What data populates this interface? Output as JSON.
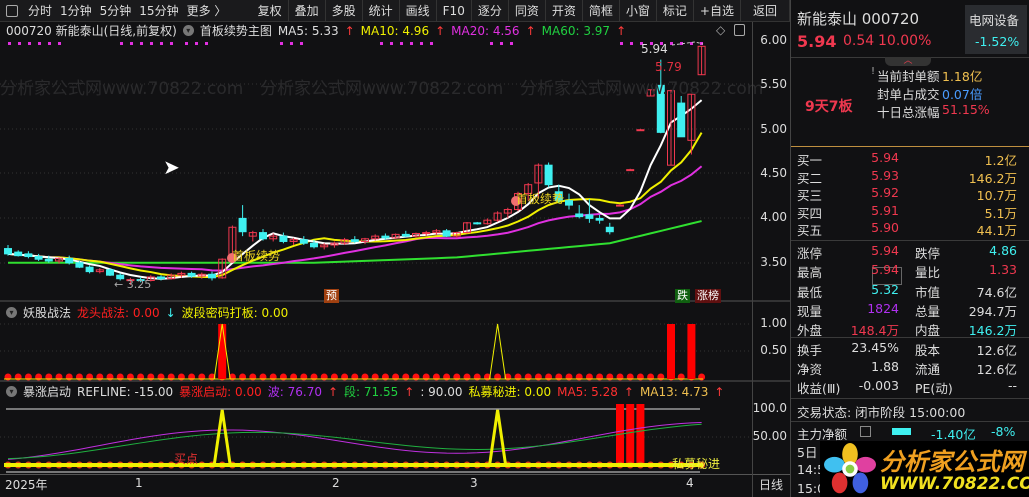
{
  "toolbar": {
    "tabs": [
      "分时",
      "1分钟",
      "5分钟",
      "15分钟",
      "更多 〉"
    ],
    "buttons": [
      "复权",
      "叠加",
      "多股",
      "统计",
      "画线",
      "F10",
      "逐分",
      "同资",
      "开资",
      "简框",
      "小窗",
      "标记",
      "+自选",
      "返回"
    ]
  },
  "legend": {
    "stock": "000720 新能泰山(日线,前复权)",
    "indicator": "首板续势主图",
    "ma5": "MA5: 5.33",
    "ma10": "MA10: 4.96",
    "ma20": "MA20: 4.56",
    "ma60": "MA60: 3.97"
  },
  "price_axis": [
    "6.00",
    "5.50",
    "5.00",
    "4.50",
    "4.00",
    "3.50"
  ],
  "annotations": {
    "high": "5.94",
    "high2": "5.79",
    "low": "← 3.25",
    "signal": "首板续势",
    "pre": "预",
    "drop": "跌",
    "rank": "涨榜",
    "buy": "买点",
    "private": "私募秘进"
  },
  "watermark": "分析家公式网www.70822.com",
  "sub1": {
    "name": "妖股战法",
    "l1": "龙头战法: 0.00",
    "l2": "波段密码打板: 0.00",
    "axis": [
      "1.00",
      "0.50"
    ]
  },
  "sub2": {
    "name": "暴涨启动",
    "refline": "REFLINE: -15.00",
    "l1": "暴涨启动: 0.00",
    "l2": "波: 76.70",
    "l3": "段: 71.55",
    "l4": ": 90.00",
    "l5": "私募秘进: 0.00",
    "l6": "MA5: 5.28",
    "l7": "MA13: 4.73",
    "axis": [
      "100.0",
      "50.00"
    ]
  },
  "time_axis": {
    "year": "2025年",
    "months": [
      "1",
      "2",
      "3",
      "4"
    ],
    "period": "日线"
  },
  "colors": {
    "up": "#f0384f",
    "down": "#3ff0f0",
    "ma5": "#ffffff",
    "ma10": "#f0f000",
    "ma20": "#e030e0",
    "ma60": "#30e030"
  },
  "candles": [
    [
      3.66,
      3.7,
      3.58,
      3.6
    ],
    [
      3.62,
      3.64,
      3.57,
      3.58
    ],
    [
      3.6,
      3.63,
      3.55,
      3.57
    ],
    [
      3.57,
      3.6,
      3.52,
      3.54
    ],
    [
      3.54,
      3.58,
      3.5,
      3.52
    ],
    [
      3.52,
      3.56,
      3.49,
      3.55
    ],
    [
      3.55,
      3.58,
      3.48,
      3.5
    ],
    [
      3.5,
      3.52,
      3.44,
      3.45
    ],
    [
      3.45,
      3.47,
      3.38,
      3.4
    ],
    [
      3.4,
      3.44,
      3.38,
      3.42
    ],
    [
      3.42,
      3.44,
      3.35,
      3.36
    ],
    [
      3.36,
      3.38,
      3.3,
      3.32
    ],
    [
      3.3,
      3.33,
      3.25,
      3.31
    ],
    [
      3.31,
      3.34,
      3.28,
      3.3
    ],
    [
      3.3,
      3.36,
      3.29,
      3.34
    ],
    [
      3.34,
      3.36,
      3.3,
      3.32
    ],
    [
      3.32,
      3.38,
      3.31,
      3.36
    ],
    [
      3.36,
      3.4,
      3.33,
      3.38
    ],
    [
      3.38,
      3.4,
      3.33,
      3.35
    ],
    [
      3.35,
      3.39,
      3.32,
      3.37
    ],
    [
      3.37,
      3.4,
      3.3,
      3.33
    ],
    [
      3.33,
      3.55,
      3.32,
      3.54
    ],
    [
      3.54,
      3.92,
      3.53,
      3.9
    ],
    [
      4.0,
      4.15,
      3.8,
      3.85
    ],
    [
      3.8,
      3.86,
      3.74,
      3.84
    ],
    [
      3.84,
      3.88,
      3.75,
      3.77
    ],
    [
      3.77,
      3.83,
      3.74,
      3.8
    ],
    [
      3.8,
      3.84,
      3.72,
      3.74
    ],
    [
      3.74,
      3.78,
      3.7,
      3.76
    ],
    [
      3.76,
      3.8,
      3.7,
      3.72
    ],
    [
      3.72,
      3.76,
      3.66,
      3.68
    ],
    [
      3.68,
      3.72,
      3.65,
      3.7
    ],
    [
      3.7,
      3.74,
      3.67,
      3.72
    ],
    [
      3.72,
      3.78,
      3.7,
      3.76
    ],
    [
      3.76,
      3.8,
      3.72,
      3.74
    ],
    [
      3.74,
      3.78,
      3.71,
      3.77
    ],
    [
      3.77,
      3.82,
      3.75,
      3.8
    ],
    [
      3.8,
      3.83,
      3.76,
      3.78
    ],
    [
      3.78,
      3.83,
      3.77,
      3.82
    ],
    [
      3.82,
      3.86,
      3.79,
      3.8
    ],
    [
      3.8,
      3.84,
      3.78,
      3.83
    ],
    [
      3.83,
      3.86,
      3.8,
      3.84
    ],
    [
      3.84,
      3.88,
      3.81,
      3.86
    ],
    [
      3.86,
      3.88,
      3.79,
      3.8
    ],
    [
      3.8,
      3.85,
      3.78,
      3.84
    ],
    [
      3.84,
      3.96,
      3.83,
      3.95
    ],
    [
      3.95,
      3.96,
      3.93,
      3.94
    ],
    [
      3.94,
      4.0,
      3.93,
      3.98
    ],
    [
      3.98,
      4.08,
      3.96,
      4.06
    ],
    [
      4.06,
      4.12,
      4.0,
      4.1
    ],
    [
      4.1,
      4.3,
      4.08,
      4.28
    ],
    [
      4.28,
      4.4,
      4.2,
      4.38
    ],
    [
      4.4,
      4.62,
      4.22,
      4.6
    ],
    [
      4.6,
      4.63,
      4.35,
      4.38
    ],
    [
      4.3,
      4.38,
      4.18,
      4.2
    ],
    [
      4.2,
      4.28,
      4.1,
      4.15
    ],
    [
      4.05,
      4.15,
      4.0,
      4.02
    ],
    [
      4.04,
      4.22,
      3.95,
      4.0
    ],
    [
      4.0,
      4.04,
      3.94,
      3.98
    ],
    [
      3.9,
      3.95,
      3.82,
      3.85
    ],
    [
      4.15,
      4.16,
      4.14,
      4.15
    ],
    [
      4.55,
      4.56,
      4.54,
      4.55
    ],
    [
      5.0,
      5.01,
      4.99,
      5.0
    ],
    [
      5.38,
      5.45,
      5.38,
      5.45
    ],
    [
      5.5,
      5.79,
      4.96,
      4.97
    ],
    [
      4.6,
      5.45,
      4.6,
      5.44
    ],
    [
      5.3,
      5.38,
      4.92,
      4.92
    ],
    [
      4.88,
      5.4,
      4.72,
      5.4
    ],
    [
      5.62,
      5.94,
      5.62,
      5.94
    ]
  ],
  "ma60_anchors": [
    [
      0,
      3.5
    ],
    [
      30,
      3.5
    ],
    [
      44,
      3.56
    ],
    [
      59,
      3.72
    ],
    [
      68,
      3.97
    ]
  ],
  "sub1_bars": [
    21,
    65,
    67
  ],
  "sub1_triangles": [
    21,
    48
  ],
  "sub2_spikes": [
    21,
    48
  ],
  "sub2_bars": [
    60,
    61,
    62
  ],
  "quote": {
    "name": "新能泰山 000720",
    "price": "5.94",
    "change": "0.54",
    "pct": "10.00%",
    "sector": "电网设备",
    "sector_pct": "-1.52%",
    "streak": "9天7板",
    "info": [
      {
        "label": "当前封单额",
        "value": "1.18亿"
      },
      {
        "label": "封单占成交",
        "value": "0.07倍"
      },
      {
        "label": "十日总涨幅",
        "value": "51.15%"
      }
    ],
    "bids": [
      {
        "label": "买一",
        "price": "5.94",
        "vol": "1.2亿"
      },
      {
        "label": "买二",
        "price": "5.93",
        "vol": "146.2万"
      },
      {
        "label": "买三",
        "price": "5.92",
        "vol": "10.7万"
      },
      {
        "label": "买四",
        "price": "5.91",
        "vol": "5.1万"
      },
      {
        "label": "买五",
        "price": "5.90",
        "vol": "44.1万"
      }
    ],
    "stats": [
      [
        "涨停",
        "5.94",
        "跌停",
        "4.86"
      ],
      [
        "最高",
        "5.94",
        "量比",
        "1.33"
      ],
      [
        "最低",
        "5.32",
        "市值",
        "74.6亿"
      ],
      [
        "现量",
        "1824",
        "总量",
        "294.7万"
      ],
      [
        "外盘",
        "148.4万",
        "内盘",
        "146.2万"
      ]
    ],
    "stats2": [
      [
        "换手",
        "23.45%",
        "股本",
        "12.6亿"
      ],
      [
        "净资",
        "1.88",
        "流通",
        "12.6亿"
      ],
      [
        "收益(Ⅲ)",
        "-0.003",
        "PE(动)",
        "--"
      ]
    ],
    "status": "交易状态: 闭市阶段 15:00:00",
    "flow_label": "主力净额",
    "flow_value": "-1.40亿",
    "flow_pct": "-8%",
    "row5": "5日",
    "t1": "14:5",
    "t2": "15:0",
    "logo_cn": "分析家公式网",
    "logo_url": "WWW.70822.COM"
  }
}
